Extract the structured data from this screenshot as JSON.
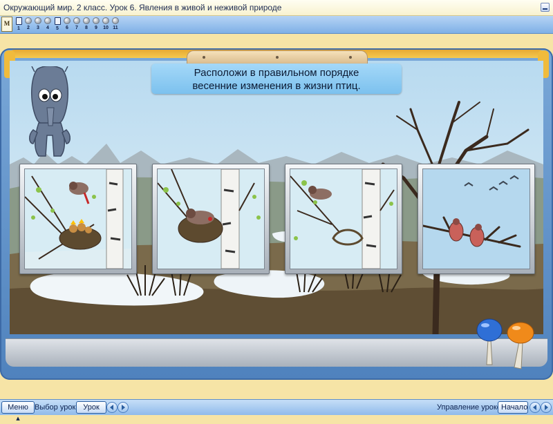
{
  "window": {
    "title": "Окружающий мир. 2 класс. Урок 6. Явления в живой и неживой природе"
  },
  "lesson_strip": {
    "logo_text": "M",
    "steps": [
      {
        "label": "1",
        "current": true
      },
      {
        "label": "2",
        "current": false
      },
      {
        "label": "3",
        "current": false
      },
      {
        "label": "4",
        "current": false
      },
      {
        "label": "5",
        "current": true
      },
      {
        "label": "6",
        "current": false
      },
      {
        "label": "7",
        "current": false
      },
      {
        "label": "8",
        "current": false
      },
      {
        "label": "9",
        "current": false
      },
      {
        "label": "10",
        "current": false
      },
      {
        "label": "11",
        "current": false
      }
    ]
  },
  "task": {
    "line1": "Расположи в правильном порядке",
    "line2": "весенние изменения в жизни птиц."
  },
  "cards": [
    {
      "scene": "chicks-in-nest"
    },
    {
      "scene": "bird-sitting-on-eggs"
    },
    {
      "scene": "bird-building-nest"
    },
    {
      "scene": "birds-returning"
    }
  ],
  "bottom": {
    "menu_label": "Меню",
    "select_lesson_label": "Выбор урока:",
    "lesson_button": "Урок",
    "control_label": "Управление уроком:",
    "start_button": "Начало"
  },
  "colors": {
    "sky": "#c9e3f2",
    "frame_blue": "#5a8cc6",
    "accent_yellow": "#f0bb3c",
    "knob_blue": "#2f6fd6",
    "knob_orange": "#f08a1a"
  }
}
